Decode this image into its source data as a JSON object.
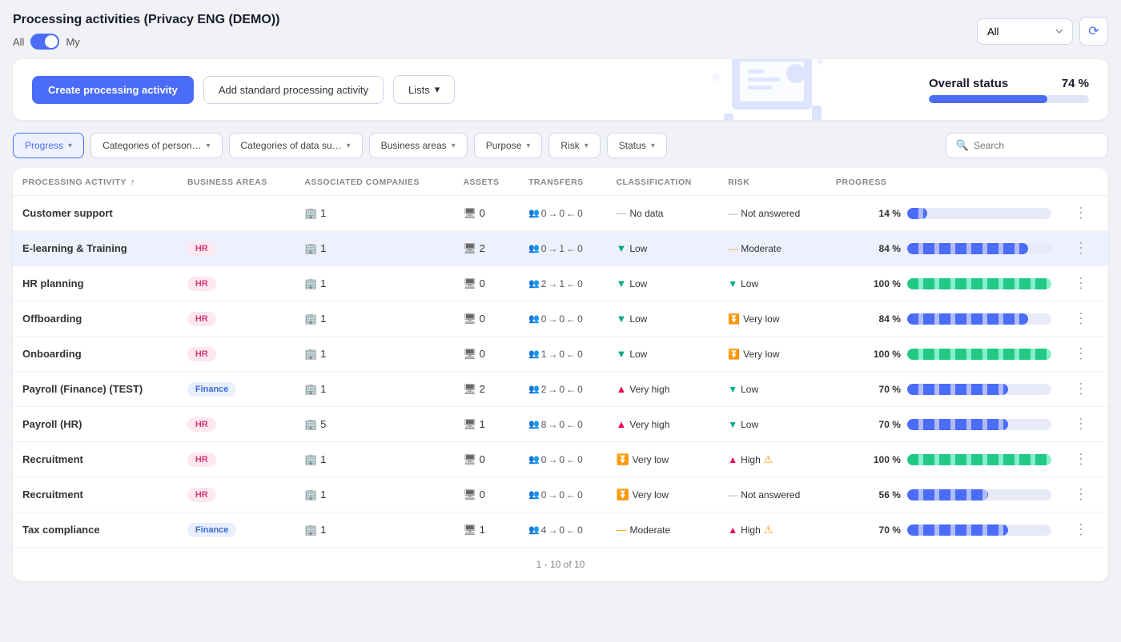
{
  "header": {
    "title": "Processing activities (Privacy ENG (DEMO))",
    "toggle_all": "All",
    "toggle_my": "My",
    "select_value": "All",
    "refresh_icon": "↻"
  },
  "banner": {
    "create_btn": "Create processing activity",
    "add_standard_btn": "Add standard processing activity",
    "lists_btn": "Lists",
    "overall_label": "Overall status",
    "overall_pct": "74 %",
    "overall_bar_width": 74
  },
  "filters": [
    {
      "id": "progress",
      "label": "Progress",
      "active": true
    },
    {
      "id": "categories_person",
      "label": "Categories of person…",
      "active": false
    },
    {
      "id": "categories_data",
      "label": "Categories of data su…",
      "active": false
    },
    {
      "id": "business_areas",
      "label": "Business areas",
      "active": false
    },
    {
      "id": "purpose",
      "label": "Purpose",
      "active": false
    },
    {
      "id": "risk",
      "label": "Risk",
      "active": false
    },
    {
      "id": "status",
      "label": "Status",
      "active": false
    }
  ],
  "search_placeholder": "Search",
  "table": {
    "columns": [
      "Processing Activity",
      "Business Areas",
      "Associated Companies",
      "Assets",
      "Transfers",
      "Classification",
      "Risk",
      "Progress"
    ],
    "rows": [
      {
        "name": "Customer support",
        "tag": null,
        "companies": "1",
        "assets": "0",
        "transfers_from": "0",
        "transfers_to": "0",
        "transfers_back": "0",
        "classification": "—",
        "classification_label": "No data",
        "risk_dir": "neutral",
        "risk_label": "Not answered",
        "progress_pct": "14 %",
        "progress_bar": 14,
        "bar_type": "blue",
        "highlighted": false
      },
      {
        "name": "E-learning & Training",
        "tag": "HR",
        "tag_type": "hr",
        "companies": "1",
        "assets": "2",
        "transfers_from": "0",
        "transfers_to": "1",
        "transfers_back": "0",
        "classification": "down",
        "classification_label": "Low",
        "risk_dir": "neutral_yellow",
        "risk_label": "Moderate",
        "progress_pct": "84 %",
        "progress_bar": 84,
        "bar_type": "blue",
        "highlighted": true
      },
      {
        "name": "HR planning",
        "tag": "HR",
        "tag_type": "hr",
        "companies": "1",
        "assets": "0",
        "transfers_from": "2",
        "transfers_to": "1",
        "transfers_back": "0",
        "classification": "down",
        "classification_label": "Low",
        "risk_dir": "down",
        "risk_label": "Low",
        "progress_pct": "100 %",
        "progress_bar": 100,
        "bar_type": "green",
        "highlighted": false
      },
      {
        "name": "Offboarding",
        "tag": "HR",
        "tag_type": "hr",
        "companies": "1",
        "assets": "0",
        "transfers_from": "0",
        "transfers_to": "0",
        "transfers_back": "0",
        "classification": "down",
        "classification_label": "Low",
        "risk_dir": "down2",
        "risk_label": "Very low",
        "progress_pct": "84 %",
        "progress_bar": 84,
        "bar_type": "blue",
        "highlighted": false
      },
      {
        "name": "Onboarding",
        "tag": "HR",
        "tag_type": "hr",
        "companies": "1",
        "assets": "0",
        "transfers_from": "1",
        "transfers_to": "0",
        "transfers_back": "0",
        "classification": "down",
        "classification_label": "Low",
        "risk_dir": "down2",
        "risk_label": "Very low",
        "progress_pct": "100 %",
        "progress_bar": 100,
        "bar_type": "green",
        "highlighted": false
      },
      {
        "name": "Payroll (Finance) (TEST)",
        "tag": "Finance",
        "tag_type": "finance",
        "companies": "1",
        "assets": "2",
        "transfers_from": "2",
        "transfers_to": "0",
        "transfers_back": "0",
        "classification": "up",
        "classification_label": "Very high",
        "risk_dir": "down",
        "risk_label": "Low",
        "progress_pct": "70 %",
        "progress_bar": 70,
        "bar_type": "blue",
        "highlighted": false
      },
      {
        "name": "Payroll (HR)",
        "tag": "HR",
        "tag_type": "hr",
        "companies": "5",
        "assets": "1",
        "transfers_from": "8",
        "transfers_to": "0",
        "transfers_back": "0",
        "classification": "up",
        "classification_label": "Very high",
        "risk_dir": "down",
        "risk_label": "Low",
        "progress_pct": "70 %",
        "progress_bar": 70,
        "bar_type": "blue",
        "highlighted": false
      },
      {
        "name": "Recruitment",
        "tag": "HR",
        "tag_type": "hr",
        "companies": "1",
        "assets": "0",
        "transfers_from": "0",
        "transfers_to": "0",
        "transfers_back": "0",
        "classification": "down2",
        "classification_label": "Very low",
        "risk_dir": "up",
        "risk_label": "High",
        "warn": true,
        "progress_pct": "100 %",
        "progress_bar": 100,
        "bar_type": "green",
        "highlighted": false
      },
      {
        "name": "Recruitment",
        "tag": "HR",
        "tag_type": "hr",
        "companies": "1",
        "assets": "0",
        "transfers_from": "0",
        "transfers_to": "0",
        "transfers_back": "0",
        "classification": "down2",
        "classification_label": "Very low",
        "risk_dir": "neutral",
        "risk_label": "Not answered",
        "progress_pct": "56 %",
        "progress_bar": 56,
        "bar_type": "blue",
        "highlighted": false
      },
      {
        "name": "Tax compliance",
        "tag": "Finance",
        "tag_type": "finance",
        "companies": "1",
        "assets": "1",
        "transfers_from": "4",
        "transfers_to": "0",
        "transfers_back": "0",
        "classification": "neutral_yellow",
        "classification_label": "Moderate",
        "risk_dir": "up",
        "risk_label": "High",
        "warn": true,
        "progress_pct": "70 %",
        "progress_bar": 70,
        "bar_type": "blue",
        "highlighted": false
      }
    ]
  },
  "pagination": "1 - 10 of 10"
}
